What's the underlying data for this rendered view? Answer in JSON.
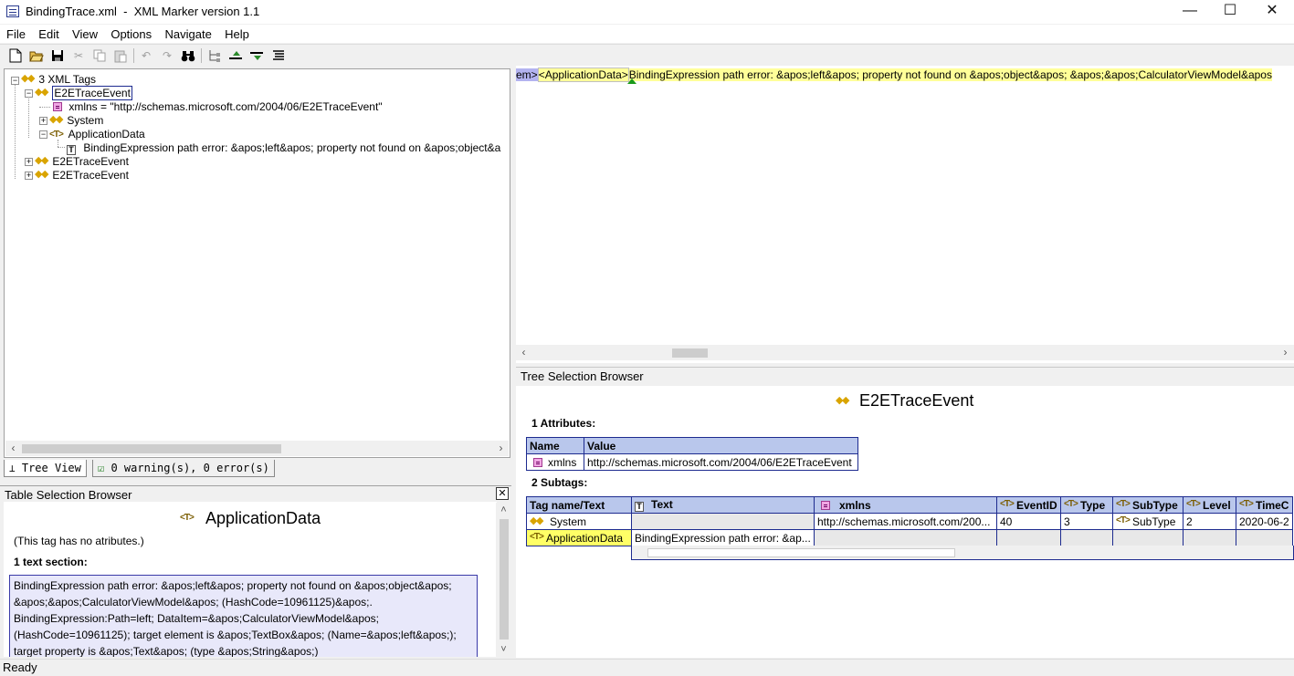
{
  "window": {
    "title": "BindingTrace.xml  -  XML Marker version 1.1",
    "minimize": "—",
    "maximize": "☐",
    "close": "✕"
  },
  "menu": [
    "File",
    "Edit",
    "View",
    "Options",
    "Navigate",
    "Help"
  ],
  "toolbar": {
    "icons": [
      "new-file-icon",
      "open-folder-icon",
      "save-icon",
      "cut-icon",
      "copy-icon",
      "paste-icon",
      "undo-icon",
      "redo-icon",
      "find-binoculars-icon",
      "tag-tree-icon",
      "move-up-icon",
      "move-down-icon",
      "format-lines-icon"
    ]
  },
  "tree": {
    "root": "3 XML Tags",
    "nodes": [
      {
        "label": "E2ETraceEvent",
        "type": "tag",
        "selected": true
      },
      {
        "label": "xmlns = \"http://schemas.microsoft.com/2004/06/E2ETraceEvent\"",
        "type": "attribute"
      },
      {
        "label": "System",
        "type": "tag"
      },
      {
        "label": "ApplicationData",
        "type": "tagtext"
      },
      {
        "label": "BindingExpression path error: &apos;left&apos; property not found on &apos;object&a",
        "type": "text"
      },
      {
        "label": "E2ETraceEvent",
        "type": "tag"
      },
      {
        "label": "E2ETraceEvent",
        "type": "tag"
      }
    ]
  },
  "tabs": {
    "tree_view": "Tree View",
    "warnings": "0 warning(s), 0 error(s)"
  },
  "table_selection": {
    "header": "Table Selection Browser",
    "close": "✕",
    "title": "ApplicationData",
    "no_attributes": "(This tag has no atributes.)",
    "text_sections": "1 text section:",
    "text": "BindingExpression path error: &apos;left&apos; property not found on &apos;object&apos;\n&apos;&apos;CalculatorViewModel&apos; (HashCode=10961125)&apos;.\nBindingExpression:Path=left; DataItem=&apos;CalculatorViewModel&apos;\n(HashCode=10961125); target element is &apos;TextBox&apos; (Name=&apos;left&apos;);\ntarget property is &apos;Text&apos; (type &apos;String&apos;)"
  },
  "text_view": {
    "selected_fragment": "em>",
    "tag": "<ApplicationData>",
    "text": "BindingExpression path error: &apos;left&apos; property not found on &apos;object&apos; &apos;&apos;CalculatorViewModel&apos"
  },
  "tree_selection": {
    "header": "Tree Selection Browser",
    "title": "E2ETraceEvent",
    "attributes_label": "1 Attributes:",
    "attr_columns": [
      "Name",
      "Value"
    ],
    "attr_rows": [
      {
        "name": "xmlns",
        "value": "http://schemas.microsoft.com/2004/06/E2ETraceEvent"
      }
    ],
    "subtags_label": "2 Subtags:",
    "subtag_columns": [
      "Tag name/Text",
      "Text",
      "xmlns",
      "EventID",
      "Type",
      "SubType",
      "Level",
      "TimeC"
    ],
    "subtag_rows": [
      {
        "tag": "System",
        "text": "",
        "xmlns": "http://schemas.microsoft.com/200...",
        "eventid": "40",
        "type": "3",
        "subtype": "SubType",
        "level": "2",
        "time": "2020-06-2"
      },
      {
        "tag": "ApplicationData",
        "text": "BindingExpression path error: &ap...",
        "xmlns": "",
        "eventid": "",
        "type": "",
        "subtype": "",
        "level": "",
        "time": ""
      }
    ]
  },
  "status": "Ready",
  "colors": {
    "tag_yellow": "#d9a400",
    "table_header": "#b9c7ec",
    "table_border": "#1d2b8f",
    "text_box_bg": "#e8e8fa",
    "highlight": "#ffff66"
  }
}
